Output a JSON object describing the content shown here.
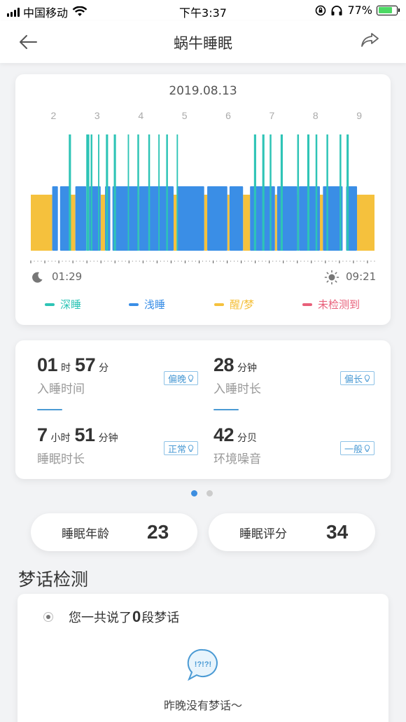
{
  "status_bar": {
    "carrier": "中国移动",
    "time": "下午3:37",
    "battery_percent": "77%",
    "battery_level": 0.77
  },
  "nav": {
    "title": "蜗牛睡眠",
    "back_icon": "arrow-left-icon",
    "share_icon": "share-icon"
  },
  "chart": {
    "date": "2019.08.13",
    "start_time": "01:29",
    "end_time": "09:21",
    "start_icon": "moon-icon",
    "end_icon": "sun-icon",
    "legend": [
      {
        "label": "深睡",
        "color": "#2ec4b6"
      },
      {
        "label": "浅睡",
        "color": "#3a8ee6"
      },
      {
        "label": "醒/梦",
        "color": "#f5c13d"
      },
      {
        "label": "未检测到",
        "color": "#e8607a"
      }
    ]
  },
  "chart_data": {
    "type": "bar",
    "title": "2019.08.13",
    "x_unit": "hour",
    "x_ticks": [
      "2",
      "3",
      "4",
      "5",
      "6",
      "7",
      "8",
      "9"
    ],
    "xlim": [
      1.48,
      9.35
    ],
    "stage_levels": {
      "deep": 3,
      "light": 2,
      "awake": 1
    },
    "series": [
      {
        "name": "醒/梦",
        "color": "#f5c13d",
        "level": 1,
        "segments": [
          [
            1.48,
            1.97
          ],
          [
            2.0,
            2.03
          ],
          [
            2.38,
            2.5
          ],
          [
            3.08,
            3.18
          ],
          [
            3.93,
            3.96
          ],
          [
            4.75,
            4.82
          ],
          [
            5.45,
            5.52
          ],
          [
            5.98,
            6.03
          ],
          [
            6.34,
            6.5
          ],
          [
            7.07,
            7.12
          ],
          [
            7.58,
            7.62
          ],
          [
            8.1,
            8.17
          ],
          [
            8.95,
            9.35
          ]
        ]
      },
      {
        "name": "浅睡",
        "color": "#3a8ee6",
        "level": 2,
        "segments": [
          [
            1.97,
            2.1
          ],
          [
            2.15,
            2.38
          ],
          [
            2.5,
            2.75
          ],
          [
            2.82,
            3.08
          ],
          [
            3.18,
            3.3
          ],
          [
            3.35,
            3.93
          ],
          [
            3.96,
            4.75
          ],
          [
            4.82,
            5.45
          ],
          [
            5.52,
            5.98
          ],
          [
            6.03,
            6.34
          ],
          [
            6.5,
            7.07
          ],
          [
            7.12,
            7.58
          ],
          [
            7.62,
            8.1
          ],
          [
            8.17,
            8.62
          ],
          [
            8.7,
            8.95
          ]
        ]
      },
      {
        "name": "深睡",
        "color": "#2ec4b6",
        "level": 3,
        "segments": [
          [
            2.35,
            2.4
          ],
          [
            2.75,
            2.82
          ],
          [
            2.85,
            2.89
          ],
          [
            3.02,
            3.05
          ],
          [
            3.2,
            3.25
          ],
          [
            3.38,
            3.43
          ],
          [
            3.7,
            3.73
          ],
          [
            3.92,
            3.96
          ],
          [
            4.17,
            4.21
          ],
          [
            4.4,
            4.43
          ],
          [
            4.58,
            4.62
          ],
          [
            4.82,
            4.85
          ],
          [
            6.59,
            6.64
          ],
          [
            6.78,
            6.83
          ],
          [
            6.95,
            6.99
          ],
          [
            7.2,
            7.25
          ],
          [
            7.58,
            7.62
          ],
          [
            7.81,
            7.86
          ],
          [
            8.0,
            8.04
          ],
          [
            8.25,
            8.29
          ],
          [
            8.55,
            8.59
          ],
          [
            8.71,
            8.76
          ]
        ]
      }
    ]
  },
  "stats": [
    {
      "parts": [
        {
          "num": "01",
          "unit": "时"
        },
        {
          "num": "57",
          "unit": "分"
        }
      ],
      "label": "入睡时间",
      "badge": "偏晚"
    },
    {
      "parts": [
        {
          "num": "28",
          "unit": "分钟"
        }
      ],
      "label": "入睡时长",
      "badge": "偏长"
    },
    {
      "parts": [
        {
          "num": "7",
          "unit": "小时"
        },
        {
          "num": "51",
          "unit": "分钟"
        }
      ],
      "label": "睡眠时长",
      "badge": "正常"
    },
    {
      "parts": [
        {
          "num": "42",
          "unit": "分贝"
        }
      ],
      "label": "环境噪音",
      "badge": "一般"
    }
  ],
  "pager": {
    "count": 2,
    "active": 0
  },
  "summary": [
    {
      "label": "睡眠年龄",
      "value": "23"
    },
    {
      "label": "睡眠评分",
      "value": "34"
    }
  ],
  "dream": {
    "section_title": "梦话检测",
    "prefix": "您一共说了",
    "count": "0",
    "suffix": "段梦话",
    "icon": "speech-bubble-icon",
    "icon_text": "!?!?!",
    "empty_text": "昨晚没有梦话～"
  }
}
